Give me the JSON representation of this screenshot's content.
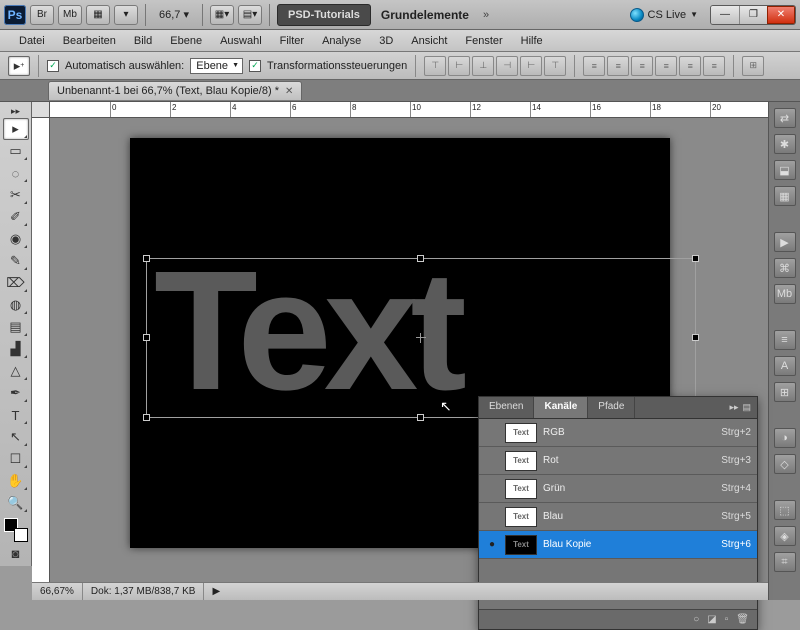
{
  "app": {
    "logo": "Ps",
    "zoom_pct": "66,7",
    "psd_tut": "PSD-Tutorials",
    "grund": "Grundelemente",
    "cslive": "CS Live"
  },
  "titlebar_btns": [
    "Br",
    "Mb",
    "▦",
    "▾"
  ],
  "win": {
    "min": "—",
    "max": "❐",
    "close": "✕"
  },
  "menu": [
    "Datei",
    "Bearbeiten",
    "Bild",
    "Ebene",
    "Auswahl",
    "Filter",
    "Analyse",
    "3D",
    "Ansicht",
    "Fenster",
    "Hilfe"
  ],
  "options": {
    "auto_select_label": "Automatisch auswählen:",
    "auto_select_check": "✓",
    "target": "Ebene",
    "transform_check": "✓",
    "transform_label": "Transformationssteuerungen"
  },
  "doc": {
    "tab_title": "Unbenannt-1 bei 66,7% (Text, Blau Kopie/8) *"
  },
  "tools": [
    "▸",
    "▭",
    "◌",
    "✂",
    "✐",
    "◉",
    "✎",
    "⌦",
    "◍",
    "▤",
    "▟",
    "△",
    "✒",
    "T",
    "↖",
    "☐",
    "✋",
    "🔍"
  ],
  "right_icons": [
    "⇄",
    "✱",
    "⬓",
    "▦",
    "▶",
    "⌘",
    "Mb",
    "≡",
    "A",
    "⊞",
    "◑",
    "◇",
    "⬚",
    "◈",
    "⌗"
  ],
  "canvas": {
    "big_text": "Text"
  },
  "panel": {
    "tabs": [
      "Ebenen",
      "Kanäle",
      "Pfade"
    ],
    "active_tab": "Kanäle",
    "channels": [
      {
        "eye": "",
        "name": "RGB",
        "key": "Strg+2",
        "dark": false
      },
      {
        "eye": "",
        "name": "Rot",
        "key": "Strg+3",
        "dark": false
      },
      {
        "eye": "",
        "name": "Grün",
        "key": "Strg+4",
        "dark": false
      },
      {
        "eye": "",
        "name": "Blau",
        "key": "Strg+5",
        "dark": false
      },
      {
        "eye": "●",
        "name": "Blau Kopie",
        "key": "Strg+6",
        "dark": true,
        "sel": true
      }
    ],
    "thumb_text": "Text",
    "footer_icons": [
      "○",
      "◪",
      "▫",
      "🗑"
    ]
  },
  "status": {
    "zoom": "66,67%",
    "dok_label": "Dok:",
    "dok": "1,37 MB/838,7 KB"
  },
  "ruler_marks": [
    "0",
    "2",
    "4",
    "6",
    "8",
    "10",
    "12",
    "14",
    "16",
    "18",
    "20"
  ]
}
